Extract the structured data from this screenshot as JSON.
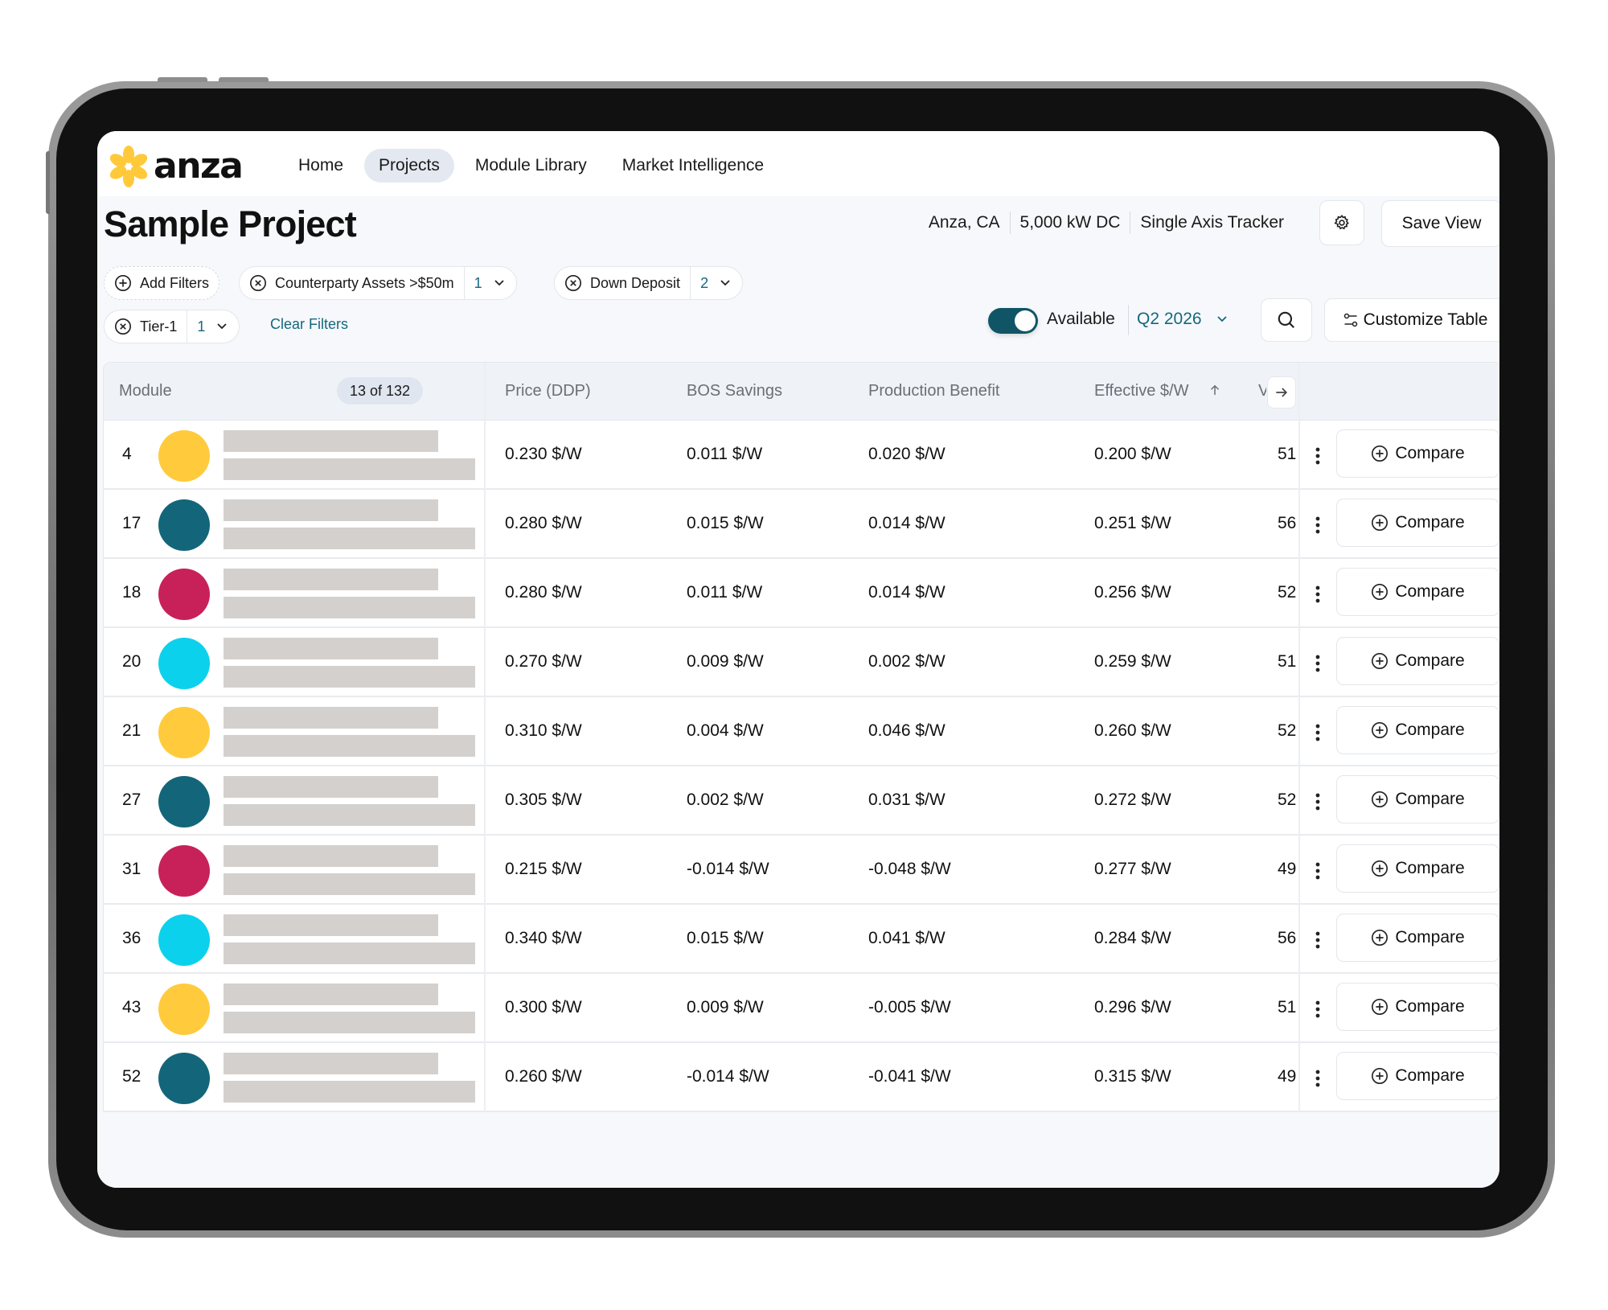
{
  "nav": {
    "logo_text": "anza",
    "items": [
      {
        "label": "Home",
        "active": false
      },
      {
        "label": "Projects",
        "active": true
      },
      {
        "label": "Module Library",
        "active": false
      },
      {
        "label": "Market Intelligence",
        "active": false
      }
    ]
  },
  "header": {
    "title": "Sample Project",
    "location": "Anza, CA",
    "capacity": "5,000 kW DC",
    "mounting": "Single Axis Tracker",
    "settings_icon": "gear-icon",
    "save_view_label": "Save View"
  },
  "filters": {
    "add_label": "Add Filters",
    "chips": [
      {
        "label": "Counterparty Assets >$50m",
        "count": "1"
      },
      {
        "label": "Down Deposit",
        "count": "2"
      },
      {
        "label": "Tier-1",
        "count": "1"
      }
    ],
    "clear_label": "Clear Filters"
  },
  "controls": {
    "toggle_label": "Available",
    "toggle_on": true,
    "quarter": "Q2 2026",
    "search_icon": "search-icon",
    "customize_label": "Customize Table"
  },
  "table": {
    "columns": {
      "module": "Module",
      "count": "13 of 132",
      "price": "Price (DDP)",
      "bos": "BOS Savings",
      "production": "Production Benefit",
      "effective": "Effective $/W",
      "next": "V"
    },
    "sort": {
      "column": "effective",
      "direction": "ascending"
    },
    "compare_label": "Compare",
    "rows": [
      {
        "rank": "4",
        "color": "#ffcb3d",
        "price": "0.230 $/W",
        "bos": "0.011 $/W",
        "production": "0.020 $/W",
        "effective": "0.200 $/W",
        "next": "51"
      },
      {
        "rank": "17",
        "color": "#13667a",
        "price": "0.280 $/W",
        "bos": "0.015 $/W",
        "production": "0.014 $/W",
        "effective": "0.251 $/W",
        "next": "56"
      },
      {
        "rank": "18",
        "color": "#c8215a",
        "price": "0.280 $/W",
        "bos": "0.011 $/W",
        "production": "0.014 $/W",
        "effective": "0.256 $/W",
        "next": "52"
      },
      {
        "rank": "20",
        "color": "#0bd1ec",
        "price": "0.270 $/W",
        "bos": "0.009 $/W",
        "production": "0.002 $/W",
        "effective": "0.259 $/W",
        "next": "51"
      },
      {
        "rank": "21",
        "color": "#ffcb3d",
        "price": "0.310 $/W",
        "bos": "0.004 $/W",
        "production": "0.046 $/W",
        "effective": "0.260 $/W",
        "next": "52"
      },
      {
        "rank": "27",
        "color": "#13667a",
        "price": "0.305 $/W",
        "bos": "0.002 $/W",
        "production": "0.031 $/W",
        "effective": "0.272 $/W",
        "next": "52"
      },
      {
        "rank": "31",
        "color": "#c8215a",
        "price": "0.215 $/W",
        "bos": "-0.014 $/W",
        "production": "-0.048 $/W",
        "effective": "0.277 $/W",
        "next": "49"
      },
      {
        "rank": "36",
        "color": "#0bd1ec",
        "price": "0.340 $/W",
        "bos": "0.015 $/W",
        "production": "0.041 $/W",
        "effective": "0.284 $/W",
        "next": "56"
      },
      {
        "rank": "43",
        "color": "#ffcb3d",
        "price": "0.300 $/W",
        "bos": "0.009 $/W",
        "production": "-0.005 $/W",
        "effective": "0.296 $/W",
        "next": "51"
      },
      {
        "rank": "52",
        "color": "#13667a",
        "price": "0.260 $/W",
        "bos": "-0.014 $/W",
        "production": "-0.041 $/W",
        "effective": "0.315 $/W",
        "next": "49"
      }
    ]
  },
  "colors": {
    "accent": "#14697d",
    "toggle": "#0f5566",
    "logo": "#ffc93a",
    "nav_active_bg": "#e4e9f1",
    "placeholder_bar": "#d3d0ce"
  }
}
